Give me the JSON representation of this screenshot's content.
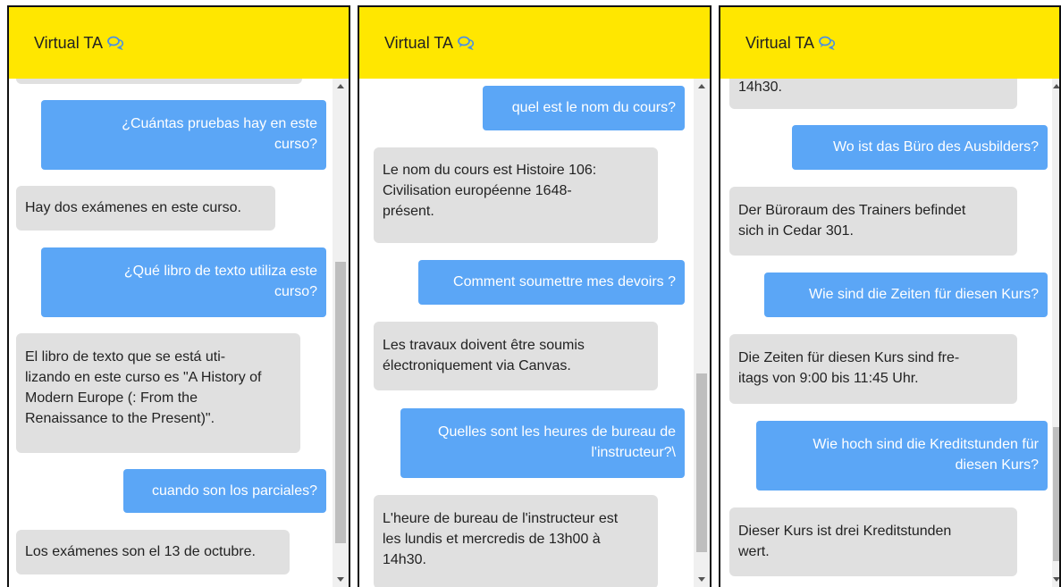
{
  "app": {
    "title": "Virtual TA",
    "header_color": "#FFE700",
    "user_bubble_color": "#5BA6F6",
    "bot_bubble_color": "#E0E0E0",
    "chat_icon": "chat-bubbles-icon"
  },
  "panels": [
    {
      "messages": [
        {
          "role": "bot",
          "text": ""
        },
        {
          "role": "user",
          "text": "¿Cuántas pruebas hay en este\ncurso?"
        },
        {
          "role": "bot",
          "text": "Hay dos exámenes en este curso."
        },
        {
          "role": "user",
          "text": "¿Qué libro de texto utiliza este\ncurso?"
        },
        {
          "role": "bot",
          "text": "El libro de texto que se está uti-\nlizando en este curso es \"A History of\nModern Europe (: From the\nRenaissance to the Present)\"."
        },
        {
          "role": "user",
          "text": "cuando son los parciales?"
        },
        {
          "role": "bot",
          "text": "Los exámenes son el 13 de octubre."
        }
      ]
    },
    {
      "messages": [
        {
          "role": "user",
          "text": "quel est le nom du cours?"
        },
        {
          "role": "bot",
          "text": "Le nom du cours est Histoire 106:\nCivilisation européenne 1648-\nprésent."
        },
        {
          "role": "user",
          "text": "Comment soumettre mes devoirs ?"
        },
        {
          "role": "bot",
          "text": "Les travaux doivent être soumis\nélectroniquement via Canvas."
        },
        {
          "role": "user",
          "text": "Quelles sont les heures de bureau de\nl'instructeur?\\"
        },
        {
          "role": "bot",
          "text": "L'heure de bureau de l'instructeur est\nles lundis et mercredis de 13h00 à\n14h30."
        }
      ]
    },
    {
      "messages": [
        {
          "role": "bot",
          "text": "14h30."
        },
        {
          "role": "user",
          "text": "Wo ist das Büro des Ausbilders?"
        },
        {
          "role": "bot",
          "text": "Der Büroraum des Trainers befindet\nsich in Cedar 301."
        },
        {
          "role": "user",
          "text": "Wie sind die Zeiten für diesen Kurs?"
        },
        {
          "role": "bot",
          "text": "Die Zeiten für diesen Kurs sind fre-\nitags von 9:00 bis 11:45 Uhr."
        },
        {
          "role": "user",
          "text": "Wie hoch sind die Kreditstunden für\ndiesen Kurs?"
        },
        {
          "role": "bot",
          "text": "Dieser Kurs ist drei Kreditstunden\nwert."
        }
      ]
    }
  ]
}
